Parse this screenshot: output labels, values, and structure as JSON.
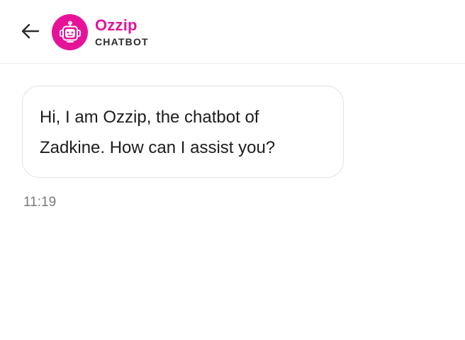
{
  "header": {
    "back_icon": "arrow-left-icon",
    "avatar_icon": "robot-icon",
    "bot_name": "Ozzip",
    "bot_subtitle": "CHATBOT",
    "accent_color": "#e6139a"
  },
  "messages": [
    {
      "sender": "bot",
      "text": "Hi, I am Ozzip, the chatbot of Zadkine. How can I assist you?",
      "time": "11:19"
    }
  ]
}
